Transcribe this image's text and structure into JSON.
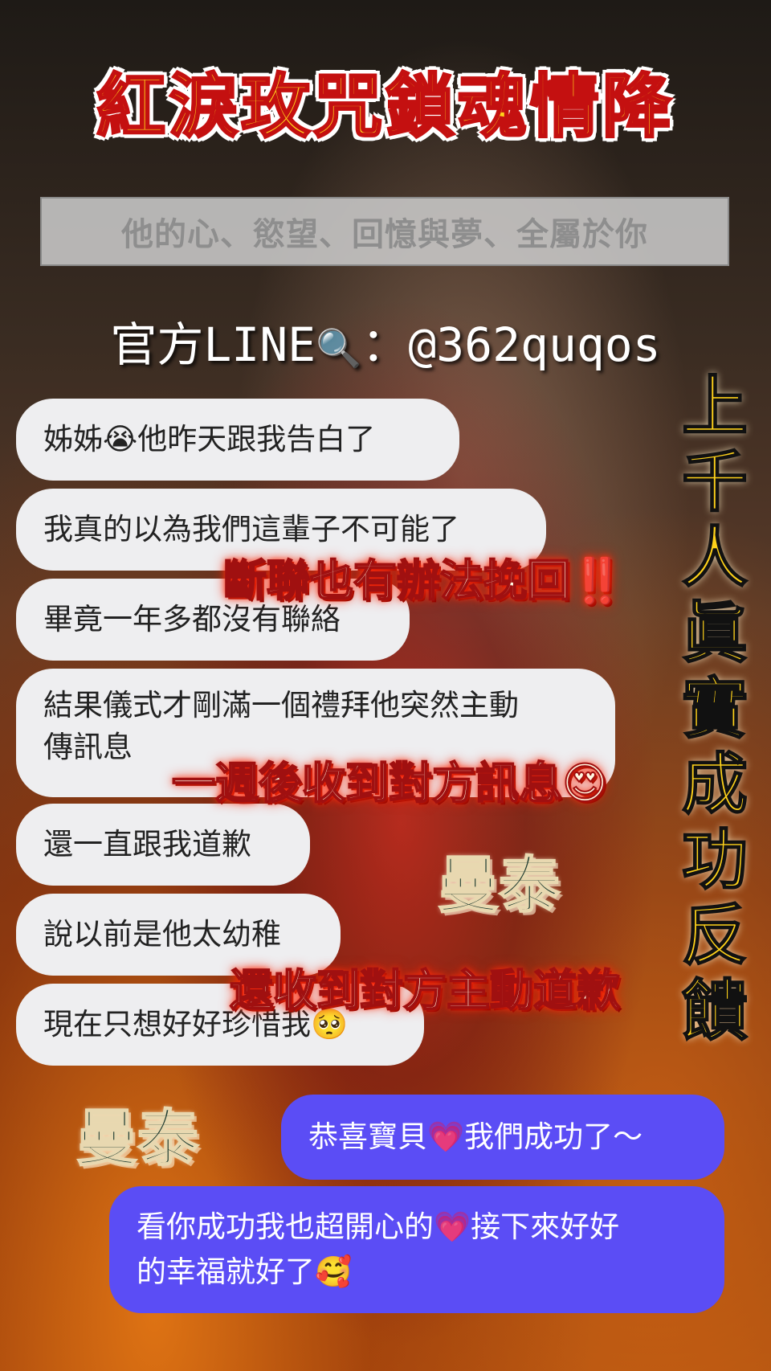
{
  "title": "紅淚玫咒鎖魂情降",
  "subtitle": "他的心、慾望、回憶與夢、全屬於你",
  "line": {
    "prefix": "官方LINE",
    "icon": "🔍",
    "sep": "：",
    "id": "@362quqos"
  },
  "incoming_messages": [
    {
      "text": "姊姊😭他昨天跟我告白了"
    },
    {
      "text": "我真的以為我們這輩子不可能了"
    },
    {
      "text": "畢竟一年多都沒有聯絡"
    },
    {
      "line1": "結果儀式才剛滿一個禮拜他突然主動",
      "line2": "傳訊息"
    },
    {
      "text": "還一直跟我道歉"
    },
    {
      "text": "說以前是他太幼稚"
    },
    {
      "text": "現在只想好好珍惜我🥺"
    }
  ],
  "outgoing_messages": [
    {
      "text": "恭喜寶貝💗我們成功了～"
    },
    {
      "line1": "看你成功我也超開心的💗接下來好好",
      "line2": "的幸福就好了🥰"
    }
  ],
  "vertical_banner": "上千人眞實成功反饋",
  "overlays": {
    "o1": "斷聯也有辦法挽回‼️",
    "o2": "一週後收到對方訊息😍",
    "o3": "還收到對方主動道歉"
  },
  "watermark": "曼泰"
}
